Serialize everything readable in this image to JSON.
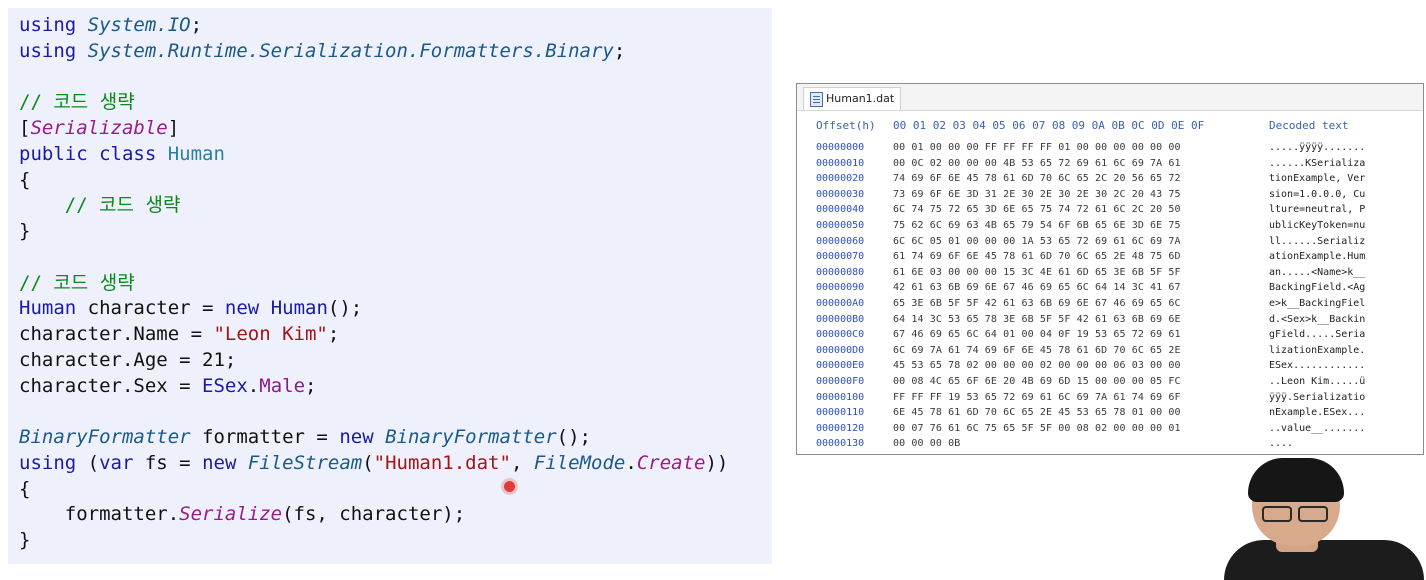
{
  "code_lines": [
    [
      {
        "t": "using ",
        "c": "kw"
      },
      {
        "t": "System.IO",
        "c": "it-cls"
      },
      {
        "t": ";",
        "c": "plain"
      }
    ],
    [
      {
        "t": "using ",
        "c": "kw"
      },
      {
        "t": "System.Runtime.Serialization.Formatters.Binary",
        "c": "it-cls"
      },
      {
        "t": ";",
        "c": "plain"
      }
    ],
    [],
    [
      {
        "t": "// 코드 생략",
        "c": "cmt"
      }
    ],
    [
      {
        "t": "[",
        "c": "plain"
      },
      {
        "t": "Serializable",
        "c": "purple-it"
      },
      {
        "t": "]",
        "c": "plain"
      }
    ],
    [
      {
        "t": "public class ",
        "c": "kw"
      },
      {
        "t": "Human",
        "c": "cls"
      }
    ],
    [
      {
        "t": "{",
        "c": "plain"
      }
    ],
    [
      {
        "t": "    // 코드 생략",
        "c": "cmt"
      }
    ],
    [
      {
        "t": "}",
        "c": "plain"
      }
    ],
    [],
    [
      {
        "t": "// 코드 생략",
        "c": "cmt"
      }
    ],
    [
      {
        "t": "Human",
        "c": "kw"
      },
      {
        "t": " character = ",
        "c": "plain"
      },
      {
        "t": "new ",
        "c": "kw"
      },
      {
        "t": "Human",
        "c": "kw"
      },
      {
        "t": "();",
        "c": "plain"
      }
    ],
    [
      {
        "t": "character.Name = ",
        "c": "plain"
      },
      {
        "t": "\"Leon Kim\"",
        "c": "str"
      },
      {
        "t": ";",
        "c": "plain"
      }
    ],
    [
      {
        "t": "character.Age = 21;",
        "c": "plain"
      }
    ],
    [
      {
        "t": "character.Sex = ",
        "c": "plain"
      },
      {
        "t": "ESex",
        "c": "kw"
      },
      {
        "t": ".",
        "c": "plain"
      },
      {
        "t": "Male",
        "c": "purple"
      },
      {
        "t": ";",
        "c": "plain"
      }
    ],
    [],
    [
      {
        "t": "BinaryFormatter",
        "c": "it-cls"
      },
      {
        "t": " formatter = ",
        "c": "plain"
      },
      {
        "t": "new ",
        "c": "kw"
      },
      {
        "t": "BinaryFormatter",
        "c": "it-cls"
      },
      {
        "t": "();",
        "c": "plain"
      }
    ],
    [
      {
        "t": "using ",
        "c": "kw"
      },
      {
        "t": "(",
        "c": "plain"
      },
      {
        "t": "var ",
        "c": "kw"
      },
      {
        "t": "fs = ",
        "c": "plain"
      },
      {
        "t": "new ",
        "c": "kw"
      },
      {
        "t": "FileStream",
        "c": "it-cls"
      },
      {
        "t": "(",
        "c": "plain"
      },
      {
        "t": "\"Human1.dat\"",
        "c": "str"
      },
      {
        "t": ", ",
        "c": "plain"
      },
      {
        "t": "FileMode",
        "c": "it-cls"
      },
      {
        "t": ".",
        "c": "plain"
      },
      {
        "t": "Create",
        "c": "purple-it"
      },
      {
        "t": "))",
        "c": "plain"
      }
    ],
    [
      {
        "t": "{",
        "c": "plain"
      }
    ],
    [
      {
        "t": "    formatter.",
        "c": "plain"
      },
      {
        "t": "Serialize",
        "c": "purple-it"
      },
      {
        "t": "(fs, character);",
        "c": "plain"
      }
    ],
    [
      {
        "t": "}",
        "c": "plain"
      }
    ]
  ],
  "hex_window": {
    "tab_label": "Human1.dat",
    "header": {
      "offset": "Offset(h)",
      "bytes": "00 01 02 03 04 05 06 07 08 09 0A 0B 0C 0D 0E 0F",
      "text": "Decoded text"
    },
    "rows": [
      {
        "offset": "00000000",
        "bytes": "00 01 00 00 00 FF FF FF FF 01 00 00 00 00 00 00",
        "text": ".....ÿÿÿÿ......."
      },
      {
        "offset": "00000010",
        "bytes": "00 0C 02 00 00 00 4B 53 65 72 69 61 6C 69 7A 61",
        "text": "......KSerializa"
      },
      {
        "offset": "00000020",
        "bytes": "74 69 6F 6E 45 78 61 6D 70 6C 65 2C 20 56 65 72",
        "text": "tionExample, Ver"
      },
      {
        "offset": "00000030",
        "bytes": "73 69 6F 6E 3D 31 2E 30 2E 30 2E 30 2C 20 43 75",
        "text": "sion=1.0.0.0, Cu"
      },
      {
        "offset": "00000040",
        "bytes": "6C 74 75 72 65 3D 6E 65 75 74 72 61 6C 2C 20 50",
        "text": "lture=neutral, P"
      },
      {
        "offset": "00000050",
        "bytes": "75 62 6C 69 63 4B 65 79 54 6F 6B 65 6E 3D 6E 75",
        "text": "ublicKeyToken=nu"
      },
      {
        "offset": "00000060",
        "bytes": "6C 6C 05 01 00 00 00 1A 53 65 72 69 61 6C 69 7A",
        "text": "ll......Serializ"
      },
      {
        "offset": "00000070",
        "bytes": "61 74 69 6F 6E 45 78 61 6D 70 6C 65 2E 48 75 6D",
        "text": "ationExample.Hum"
      },
      {
        "offset": "00000080",
        "bytes": "61 6E 03 00 00 00 15 3C 4E 61 6D 65 3E 6B 5F 5F",
        "text": "an.....<Name>k__"
      },
      {
        "offset": "00000090",
        "bytes": "42 61 63 6B 69 6E 67 46 69 65 6C 64 14 3C 41 67",
        "text": "BackingField.<Ag"
      },
      {
        "offset": "000000A0",
        "bytes": "65 3E 6B 5F 5F 42 61 63 6B 69 6E 67 46 69 65 6C",
        "text": "e>k__BackingFiel"
      },
      {
        "offset": "000000B0",
        "bytes": "64 14 3C 53 65 78 3E 6B 5F 5F 42 61 63 6B 69 6E",
        "text": "d.<Sex>k__Backin"
      },
      {
        "offset": "000000C0",
        "bytes": "67 46 69 65 6C 64 01 00 04 0F 19 53 65 72 69 61",
        "text": "gField.....Seria"
      },
      {
        "offset": "000000D0",
        "bytes": "6C 69 7A 61 74 69 6F 6E 45 78 61 6D 70 6C 65 2E",
        "text": "lizationExample."
      },
      {
        "offset": "000000E0",
        "bytes": "45 53 65 78 02 00 00 00 02 00 00 00 06 03 00 00",
        "text": "ESex............"
      },
      {
        "offset": "000000F0",
        "bytes": "00 08 4C 65 6F 6E 20 4B 69 6D 15 00 00 00 05 FC",
        "text": "..Leon Kim.....ü"
      },
      {
        "offset": "00000100",
        "bytes": "FF FF FF 19 53 65 72 69 61 6C 69 7A 61 74 69 6F",
        "text": "ÿÿÿ.Serializatio"
      },
      {
        "offset": "00000110",
        "bytes": "6E 45 78 61 6D 70 6C 65 2E 45 53 65 78 01 00 00",
        "text": "nExample.ESex..."
      },
      {
        "offset": "00000120",
        "bytes": "00 07 76 61 6C 75 65 5F 5F 00 08 02 00 00 00 01",
        "text": "..value__......."
      },
      {
        "offset": "00000130",
        "bytes": "00 00 00 0B",
        "text": "...."
      }
    ]
  },
  "colors": {
    "code_background": "#eef1fb",
    "keyword": "#1a1aa6",
    "string": "#a31515",
    "comment": "#0a8a1a",
    "enum_member": "#8a1c8a",
    "hex_offset": "#2c4fbf"
  },
  "icons": {
    "file_tab": "file-icon"
  }
}
